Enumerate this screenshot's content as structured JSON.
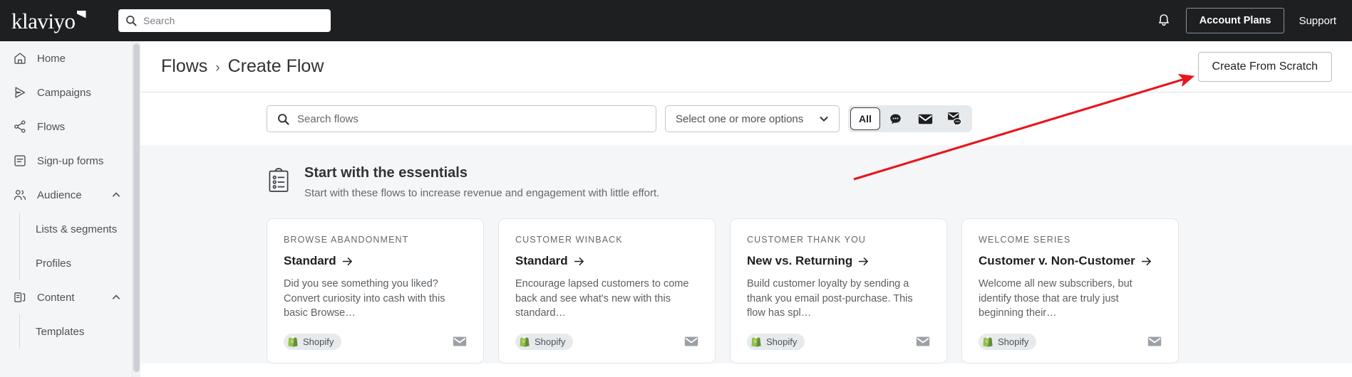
{
  "topbar": {
    "logo_text": "klaviyo",
    "logo_icon": "klaviyo-flag-mark",
    "search": {
      "icon": "search-icon",
      "placeholder": "Search",
      "value": ""
    },
    "bell_icon": "notification-bell-icon",
    "account_plans_label": "Account Plans",
    "support_label": "Support"
  },
  "sidebar": {
    "items": [
      {
        "label": "Home",
        "icon": "home-icon",
        "expandable": false
      },
      {
        "label": "Campaigns",
        "icon": "campaigns-send-icon",
        "expandable": false
      },
      {
        "label": "Flows",
        "icon": "flows-nodes-icon",
        "expandable": false
      },
      {
        "label": "Sign-up forms",
        "icon": "signup-forms-icon",
        "expandable": false
      },
      {
        "label": "Audience",
        "icon": "audience-people-icon",
        "expandable": true,
        "expanded": true,
        "children": [
          {
            "label": "Lists & segments"
          },
          {
            "label": "Profiles"
          }
        ]
      },
      {
        "label": "Content",
        "icon": "content-library-icon",
        "expandable": true,
        "expanded": true,
        "children": [
          {
            "label": "Templates"
          }
        ]
      }
    ],
    "chevron_icon": "chevron-up-icon"
  },
  "breadcrumb": {
    "root_label": "Flows",
    "separator": "›",
    "current_label": "Create Flow"
  },
  "header_actions": {
    "create_from_scratch_label": "Create From Scratch"
  },
  "filters": {
    "search": {
      "icon": "search-icon",
      "placeholder": "Search flows",
      "value": ""
    },
    "select": {
      "label": "Select one or more options",
      "icon": "chevron-down-icon"
    },
    "segmented": {
      "selected": "All",
      "options": [
        {
          "label": "All",
          "icon": "",
          "selected": true
        },
        {
          "label": "",
          "icon": "sms-bubble-icon",
          "selected": false
        },
        {
          "label": "",
          "icon": "email-envelope-icon",
          "selected": false
        },
        {
          "label": "",
          "icon": "email-and-sms-icon",
          "selected": false
        }
      ]
    }
  },
  "essentials": {
    "icon": "clipboard-checklist-icon",
    "title": "Start with the essentials",
    "subtitle": "Start with these flows to increase revenue and engagement with little effort.",
    "cards": [
      {
        "category": "BROWSE ABANDONMENT",
        "title": "Standard",
        "arrow_icon": "arrow-right-icon",
        "description": "Did you see something you liked? Convert curiosity into cash with this basic Browse…",
        "integration": {
          "label": "Shopify",
          "icon": "shopify-bag-icon"
        },
        "channel_icon": "email-envelope-icon"
      },
      {
        "category": "CUSTOMER WINBACK",
        "title": "Standard",
        "arrow_icon": "arrow-right-icon",
        "description": "Encourage lapsed customers to come back and see what's new with this standard…",
        "integration": {
          "label": "Shopify",
          "icon": "shopify-bag-icon"
        },
        "channel_icon": "email-envelope-icon"
      },
      {
        "category": "CUSTOMER THANK YOU",
        "title": "New vs. Returning",
        "arrow_icon": "arrow-right-icon",
        "description": "Build customer loyalty by sending a thank you email post-purchase. This flow has spl…",
        "integration": {
          "label": "Shopify",
          "icon": "shopify-bag-icon"
        },
        "channel_icon": "email-envelope-icon"
      },
      {
        "category": "WELCOME SERIES",
        "title": "Customer v. Non-Customer",
        "arrow_icon": "arrow-right-icon",
        "description": "Welcome all new subscribers, but identify those that are truly just beginning their…",
        "integration": {
          "label": "Shopify",
          "icon": "shopify-bag-icon"
        },
        "channel_icon": "email-envelope-icon"
      }
    ]
  },
  "annotation": {
    "type": "arrow",
    "color": "#e8151b",
    "points_to": "create-from-scratch-button"
  },
  "colors": {
    "topbar_bg": "#1d1f21",
    "sidebar_bg": "#f4f5f7",
    "section_bg": "#f5f6f8",
    "shopify_green": "#5ea22e",
    "annotation_red": "#e8151b"
  }
}
